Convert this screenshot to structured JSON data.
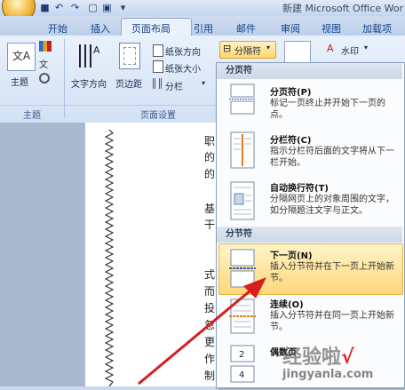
{
  "window": {
    "title": "新建 Microsoft Office Wor"
  },
  "tabs": [
    "开始",
    "插入",
    "页面布局",
    "引用",
    "邮件",
    "审阅",
    "视图",
    "加载项"
  ],
  "ribbon": {
    "theme_label": "主题",
    "text_direction": "文字方向",
    "margins": "页边距",
    "orientation": "纸张方向",
    "size": "纸张大小",
    "columns": "分栏",
    "breaks": "分隔符",
    "watermark": "水印",
    "group_theme": "主题",
    "group_page_setup": "页面设置"
  },
  "document": {
    "lines": [
      "职",
      "的",
      "的",
      "基",
      "干",
      "式",
      "而",
      "投",
      "忽",
      "更",
      "作",
      "制"
    ]
  },
  "menu": {
    "section_page": "分页符",
    "section_section": "分节符",
    "items": [
      {
        "title": "分页符(P)",
        "desc": "标记一页终止并开始下一页的点。"
      },
      {
        "title": "分栏符(C)",
        "desc": "指示分栏符后面的文字将从下一栏开始。"
      },
      {
        "title": "自动换行符(T)",
        "desc": "分隔网页上的对象周围的文字，如分隔题注文字与正文。"
      },
      {
        "title": "下一页(N)",
        "desc": "插入分节符并在下一页上开始新节。"
      },
      {
        "title": "连续(O)",
        "desc": "插入分节符并在同一页上开始新节。"
      },
      {
        "title": "偶数页",
        "desc": ""
      }
    ]
  },
  "watermark_logo": "经验啦",
  "watermark_url": "jingyanla.com",
  "colors": {
    "highlight": "#ffd77a",
    "arrow": "#d42020"
  }
}
